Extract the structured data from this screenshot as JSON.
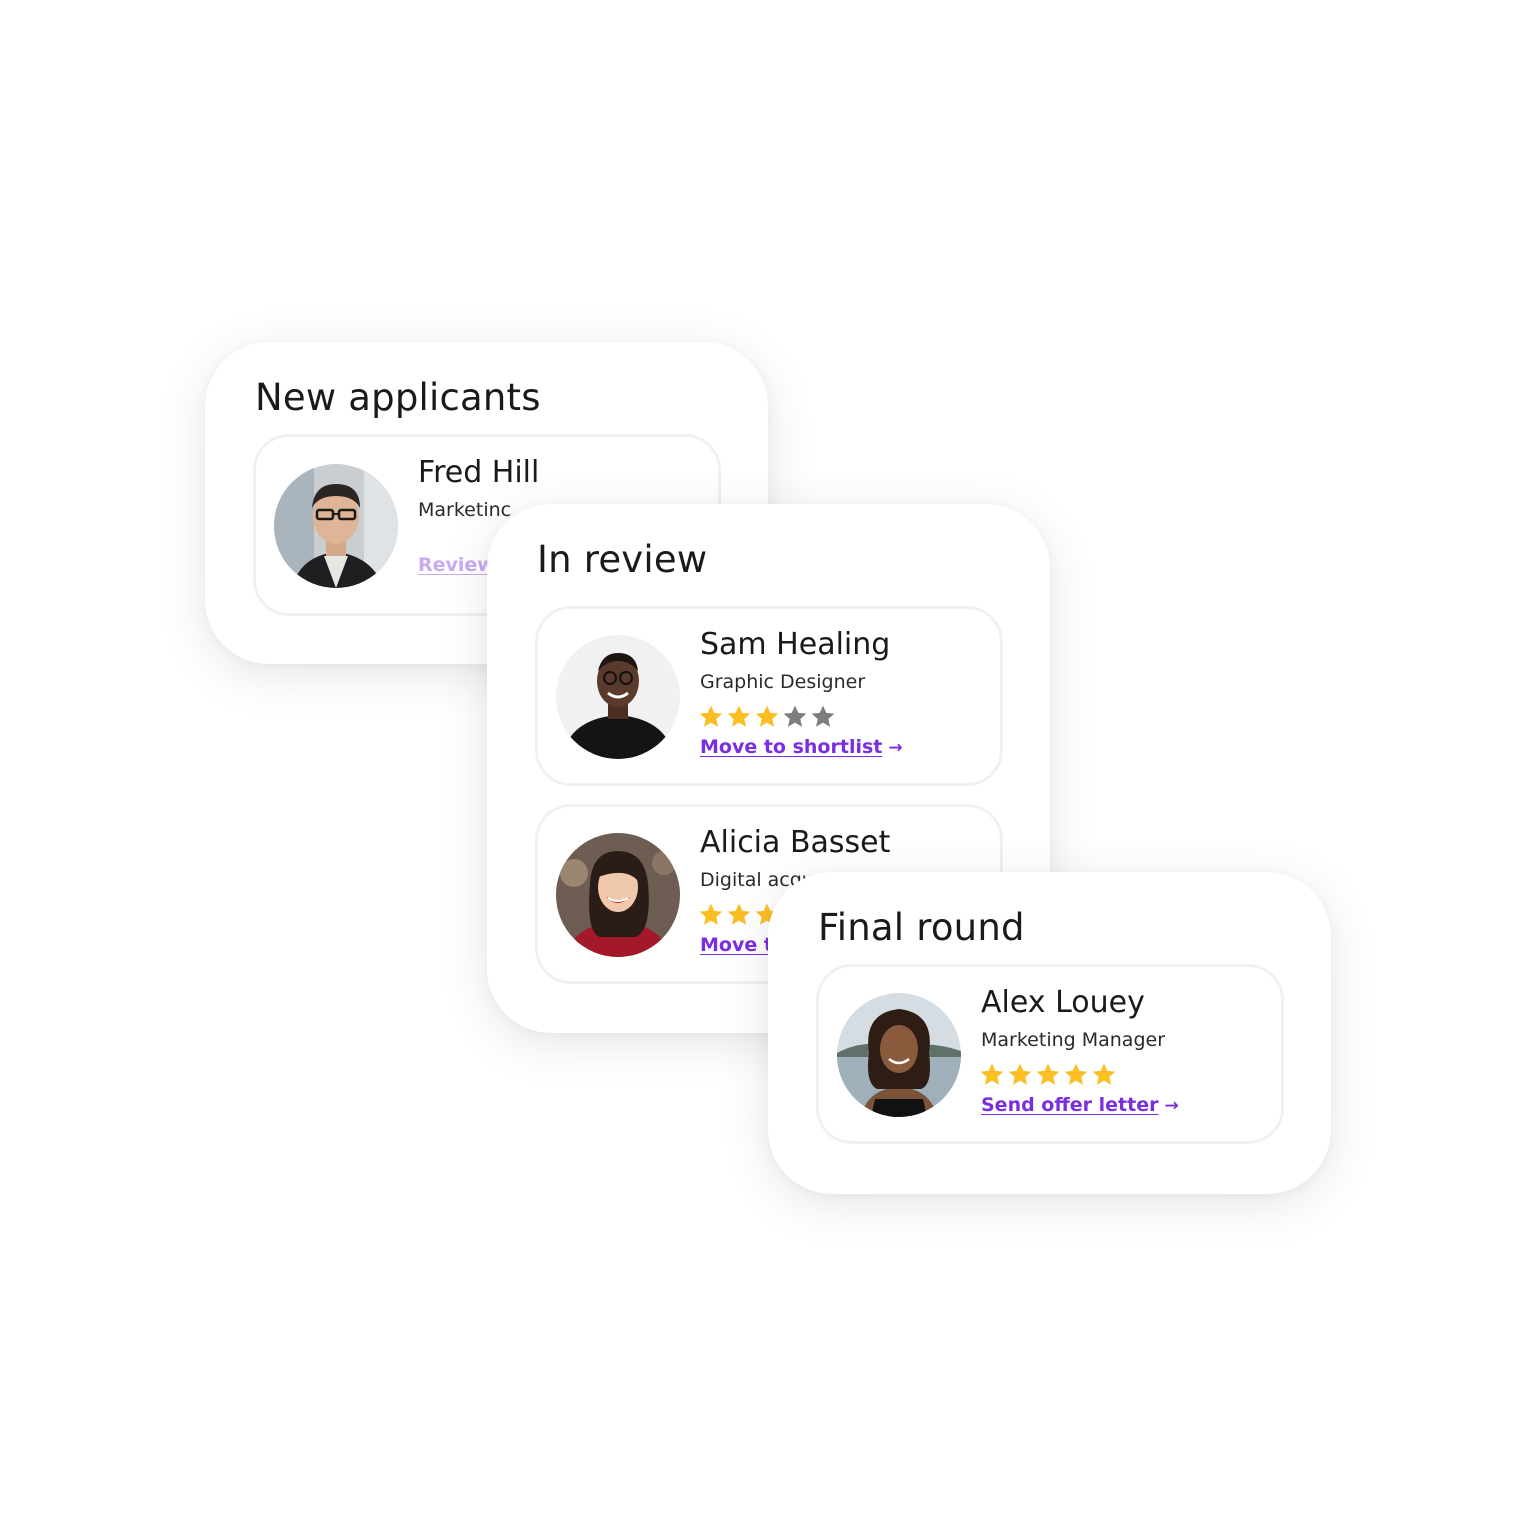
{
  "colors": {
    "accent": "#7a2ee0",
    "accent_faded": "#c9a9f2",
    "star_filled": "#fbbf24",
    "star_empty": "#7d7d7d"
  },
  "panels": [
    {
      "title": "New applicants",
      "cards": [
        {
          "name": "Fred Hill",
          "role": "Marketinc",
          "action": "Review :",
          "rating": null
        }
      ]
    },
    {
      "title": "In review",
      "cards": [
        {
          "name": "Sam Healing",
          "role": "Graphic Designer",
          "rating": 3,
          "rating_max": 5,
          "action": "Move to shortlist",
          "arrow": "→"
        },
        {
          "name": "Alicia Basset",
          "role": "Digital acqu",
          "rating": 3,
          "rating_max": 5,
          "action": "Move to"
        }
      ]
    },
    {
      "title": "Final round",
      "cards": [
        {
          "name": "Alex Louey",
          "role": "Marketing Manager",
          "rating": 5,
          "rating_max": 5,
          "action": "Send offer letter",
          "arrow": "→"
        }
      ]
    }
  ],
  "icons": {
    "star": "star-icon",
    "arrow": "arrow-right-icon",
    "avatar": "avatar-photo"
  }
}
